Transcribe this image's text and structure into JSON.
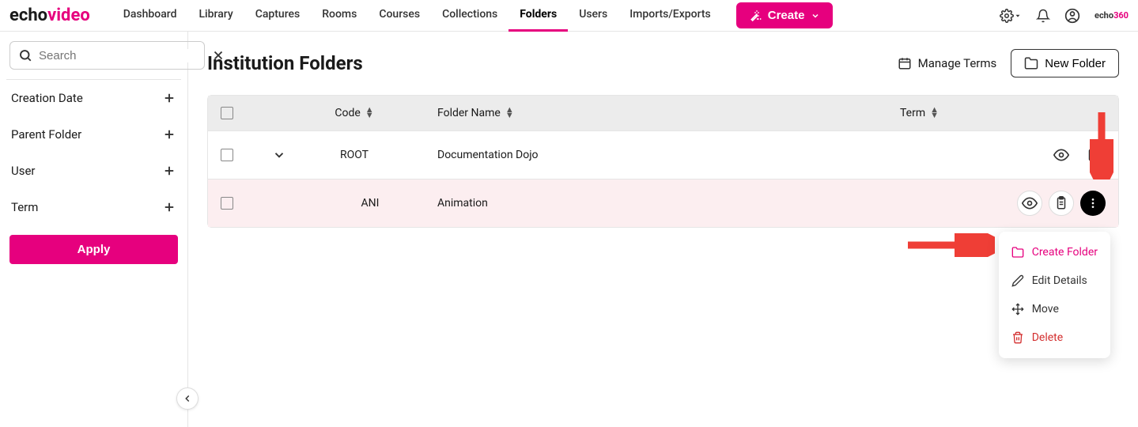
{
  "header": {
    "logo": {
      "echo": "echo",
      "video": "video"
    },
    "nav": [
      "Dashboard",
      "Library",
      "Captures",
      "Rooms",
      "Courses",
      "Collections",
      "Folders",
      "Users",
      "Imports/Exports"
    ],
    "nav_active_index": 6,
    "create_btn": "Create",
    "small_logo": {
      "echo": "echo",
      "num": "360"
    }
  },
  "sidebar": {
    "search_placeholder": "Search",
    "filters": [
      "Creation Date",
      "Parent Folder",
      "User",
      "Term"
    ],
    "apply": "Apply"
  },
  "content": {
    "title": "Institution Folders",
    "manage_terms": "Manage Terms",
    "new_folder": "New Folder"
  },
  "table": {
    "headers": {
      "code": "Code",
      "name": "Folder Name",
      "term": "Term"
    },
    "rows": [
      {
        "code": "ROOT",
        "name": "Documentation Dojo",
        "term": "",
        "expandable": true,
        "highlighted": false
      },
      {
        "code": "ANI",
        "name": "Animation",
        "term": "",
        "expandable": false,
        "highlighted": true
      }
    ]
  },
  "dropdown": {
    "items": [
      {
        "label": "Create Folder",
        "icon": "folder",
        "class": "accent"
      },
      {
        "label": "Edit Details",
        "icon": "pencil",
        "class": ""
      },
      {
        "label": "Move",
        "icon": "move",
        "class": ""
      },
      {
        "label": "Delete",
        "icon": "trash",
        "class": "danger"
      }
    ]
  }
}
